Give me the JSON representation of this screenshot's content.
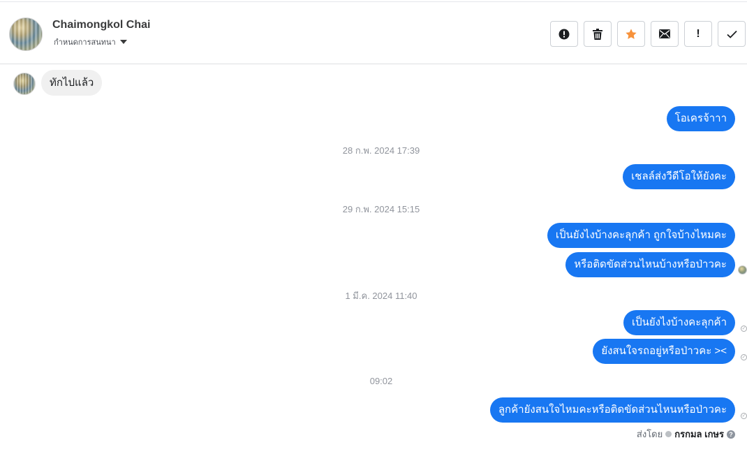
{
  "header": {
    "contact_name": "Chaimongkol Chai",
    "assign_label": "กำหนดการสนทนา",
    "actions": [
      {
        "name": "mark-spam-button",
        "icon": "alert-circle-icon"
      },
      {
        "name": "delete-button",
        "icon": "trash-icon"
      },
      {
        "name": "star-button",
        "icon": "star-icon"
      },
      {
        "name": "mark-unread-button",
        "icon": "envelope-icon"
      },
      {
        "name": "follow-up-button",
        "icon": "exclamation-icon",
        "glyph": "!"
      },
      {
        "name": "mark-done-button",
        "icon": "check-icon"
      }
    ]
  },
  "messages": {
    "incoming_1": "ทักไปแล้ว",
    "out_1": "โอเครจ้าาา",
    "ts_1": "28 ก.พ. 2024 17:39",
    "out_2": "เชลล์ส่งวีดีโอให้ยังคะ",
    "ts_2": "29 ก.พ. 2024 15:15",
    "out_3": "เป็นยังไงบ้างคะลุกค้า ถูกใจบ้างไหมคะ",
    "out_4": "หรือติดขัดส่วนไหนบ้างหรือป่าวคะ",
    "ts_3": "1 มี.ค. 2024 11:40",
    "out_5": "เป็นยังไงบ้างคะลุกค้า",
    "out_6": "ยังสนใจรถอยู่หรือป่าวคะ ><",
    "ts_4": "09:02",
    "out_7": "ลูกค้ายังสนใจไหมคะหรือติดขัดส่วนไหนหรือป่าวคะ"
  },
  "footer": {
    "sent_by_label": "ส่งโดย",
    "sent_by_name": "กรกมล เกษร",
    "help_glyph": "?"
  },
  "colors": {
    "bubble_outgoing": "#1877f2",
    "bubble_incoming": "#f0f0f0",
    "star": "#f7923b"
  }
}
